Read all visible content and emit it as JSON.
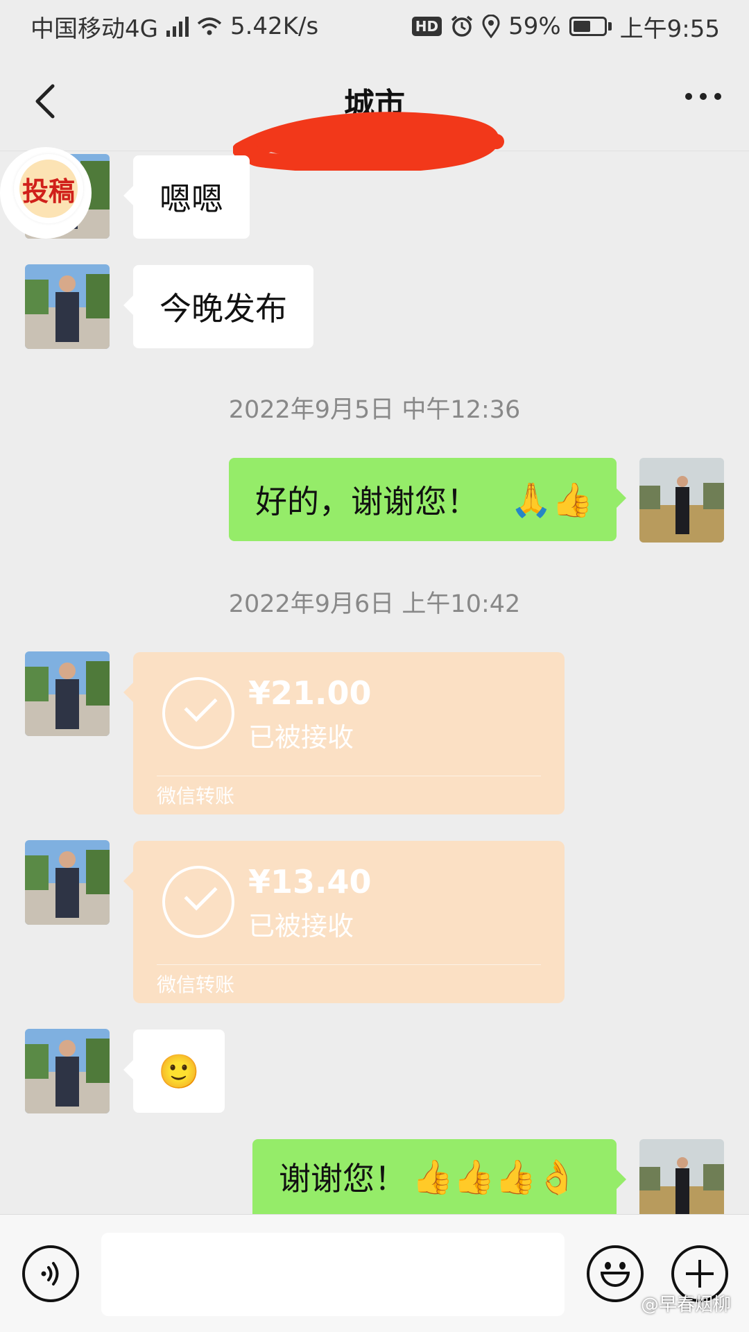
{
  "status_bar": {
    "carrier": "中国移动4G",
    "network_badge": "4G",
    "speed": "5.42K/s",
    "hd": "HD",
    "battery": "59%",
    "battery_level": 0.59,
    "time": "上午9:55",
    "icons": [
      "signal-icon",
      "wifi-icon",
      "alarm-icon",
      "location-icon",
      "battery-icon"
    ]
  },
  "header": {
    "title": "城市",
    "back_icon": "chevron-left-icon",
    "more_icon": "more-dots-icon"
  },
  "sticker": {
    "text": "投稿"
  },
  "messages": [
    {
      "side": "left",
      "type": "text",
      "text": "嗯嗯"
    },
    {
      "side": "left",
      "type": "text",
      "text": "今晚发布"
    },
    {
      "type": "timestamp",
      "text": "2022年9月5日 中午12:36"
    },
    {
      "side": "right",
      "type": "text",
      "text": "好的，谢谢您！",
      "emoji": "🙏👍"
    },
    {
      "type": "timestamp",
      "text": "2022年9月6日 上午10:42"
    },
    {
      "side": "left",
      "type": "transfer",
      "amount": "¥21.00",
      "status": "已被接收",
      "label": "微信转账"
    },
    {
      "side": "left",
      "type": "transfer",
      "amount": "¥13.40",
      "status": "已被接收",
      "label": "微信转账"
    },
    {
      "side": "left",
      "type": "emoji",
      "emoji": "🙂"
    },
    {
      "side": "right",
      "type": "text",
      "text": "谢谢您！",
      "emoji": "👍👍👍👌"
    }
  ],
  "input_bar": {
    "voice_icon": "voice-icon",
    "emoji_icon": "emoji-icon",
    "plus_icon": "plus-icon",
    "placeholder": ""
  },
  "watermark": "@早春烟柳",
  "colors": {
    "background": "#ededed",
    "green_bubble": "#95ec69",
    "transfer_bubble": "#fbe0c4"
  }
}
